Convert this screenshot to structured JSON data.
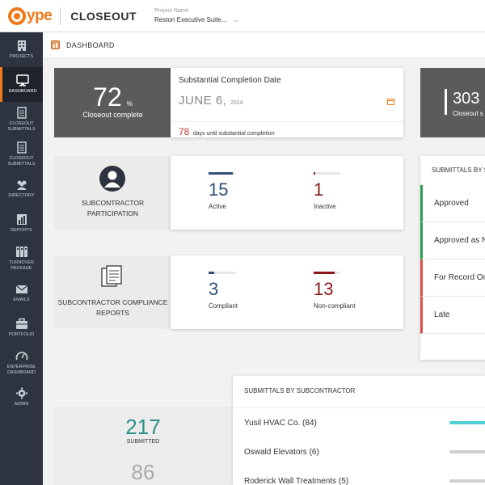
{
  "header": {
    "logo_text": "ype",
    "product": "CLOSEOUT",
    "project_label": "Project Name",
    "project_value": "Reston Executive Suite...",
    "caret": "⌄"
  },
  "sidebar": {
    "items": [
      {
        "label": "PROJECTS",
        "icon": "building-icon"
      },
      {
        "label": "DASHBOARD",
        "icon": "monitor-icon"
      },
      {
        "label": "CLOSEOUT SUBMITTALS",
        "icon": "document-icon"
      },
      {
        "label": "CLOSEOUT SUBMITTALS",
        "icon": "document-icon"
      },
      {
        "label": "DIRECTORY",
        "icon": "people-icon"
      },
      {
        "label": "REPORTS",
        "icon": "chart-icon"
      },
      {
        "label": "TURNOVER PACKAGE",
        "icon": "binders-icon"
      },
      {
        "label": "EMAILS",
        "icon": "envelope-icon"
      },
      {
        "label": "PORTFOLIO",
        "icon": "briefcase-icon"
      },
      {
        "label": "ENTERPRISE DASHBOARD",
        "icon": "gauge-icon"
      },
      {
        "label": "ADMIN",
        "icon": "gear-icon"
      }
    ]
  },
  "breadcrumb": {
    "title": "DASHBOARD"
  },
  "closeout": {
    "percent": "72",
    "percent_sign": "%",
    "label": "Closeout complete"
  },
  "completion": {
    "title": "Substantial Completion Date",
    "month_day": "JUNE 6,",
    "year": "2024",
    "days": "78",
    "days_label": "days until substantial completion"
  },
  "right_dark": {
    "number": "303",
    "label": "Closeout s"
  },
  "participation": {
    "title_line1": "SUBCONTRACTOR",
    "title_line2": "PARTICIPATION",
    "active": {
      "value": "15",
      "label": "Active",
      "fill": 0.92
    },
    "inactive": {
      "value": "1",
      "label": "Inactive",
      "fill": 0.06
    }
  },
  "compliance": {
    "title_line1": "SUBCONTRACTOR COMPLIANCE",
    "title_line2": "REPORTS",
    "compliant": {
      "value": "3",
      "label": "Compliant",
      "fill": 0.2
    },
    "noncompliant": {
      "value": "13",
      "label": "Non-compliant",
      "fill": 0.8
    }
  },
  "submittals_status": {
    "title": "SUBMITTALS BY S",
    "rows": [
      {
        "label": "Approved",
        "color": "#2e9e4f"
      },
      {
        "label": "Approved as N",
        "color": "#2e9e4f"
      },
      {
        "label": "For Record On",
        "color": "#d9534f"
      },
      {
        "label": "Late",
        "color": "#d9534f"
      }
    ]
  },
  "submitted": {
    "value": "217",
    "label": "SUBMITTED",
    "second_value": "86"
  },
  "by_subcontractor": {
    "title": "SUBMITTALS BY SUBCONTRACTOR",
    "rows": [
      {
        "label": "Yusil HVAC Co. (84)",
        "color": "#4ecfd6"
      },
      {
        "label": "Oswald Elevators (6)",
        "color": "#cfcfcf"
      },
      {
        "label": "Roderick Wall Treatments (5)",
        "color": "#cfcfcf"
      }
    ]
  },
  "colors": {
    "accent": "#f07a1a",
    "blue": "#2f4f7a",
    "red": "#8b1a1a",
    "teal": "#2a8f8a"
  }
}
